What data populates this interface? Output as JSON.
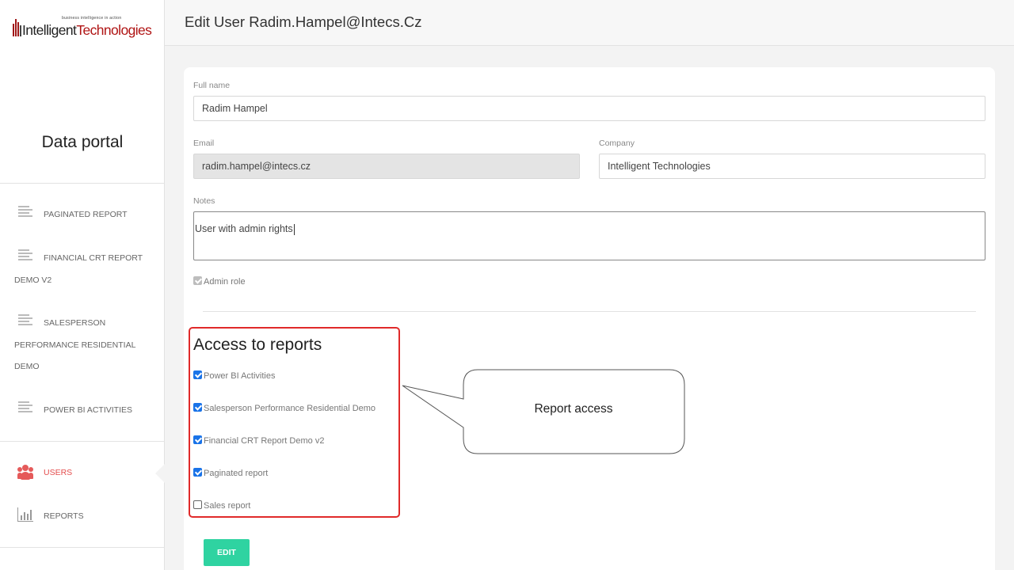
{
  "logo": {
    "tagline": "business intelligence in action",
    "name_part1": "Intelligent",
    "name_part2": "Technologies"
  },
  "sidebar": {
    "portal_title": "Data portal",
    "reports": [
      {
        "line1": "PAGINATED REPORT"
      },
      {
        "line1": "FINANCIAL CRT REPORT",
        "line2": "DEMO V2"
      },
      {
        "line1": "SALESPERSON",
        "line2": "PERFORMANCE RESIDENTIAL",
        "line3": "DEMO"
      },
      {
        "line1": "POWER BI ACTIVITIES"
      }
    ],
    "admin": [
      {
        "label": "USERS",
        "icon": "users-icon",
        "active": true
      },
      {
        "label": "REPORTS",
        "icon": "bar-chart-icon",
        "active": false
      }
    ]
  },
  "header": {
    "title": "Edit User Radim.Hampel@Intecs.Cz"
  },
  "form": {
    "full_name_label": "Full name",
    "full_name_value": "Radim Hampel",
    "email_label": "Email",
    "email_value": "radim.hampel@intecs.cz",
    "company_label": "Company",
    "company_value": "Intelligent Technologies",
    "notes_label": "Notes",
    "notes_value": "User with admin rights",
    "admin_role_label": "Admin role",
    "admin_role_checked": true
  },
  "access": {
    "title": "Access to reports",
    "items": [
      {
        "label": "Power BI Activities",
        "checked": true
      },
      {
        "label": "Salesperson Performance Residential Demo",
        "checked": true
      },
      {
        "label": "Financial CRT Report Demo v2",
        "checked": true
      },
      {
        "label": "Paginated report",
        "checked": true
      },
      {
        "label": "Sales report",
        "checked": false
      }
    ]
  },
  "callout": {
    "text": "Report access"
  },
  "actions": {
    "edit_label": "EDIT"
  },
  "colors": {
    "accent_green": "#2fd3a1",
    "highlight_red": "#e02a2a",
    "active_nav": "#e44d4d",
    "checkbox_blue": "#1a73e8"
  }
}
